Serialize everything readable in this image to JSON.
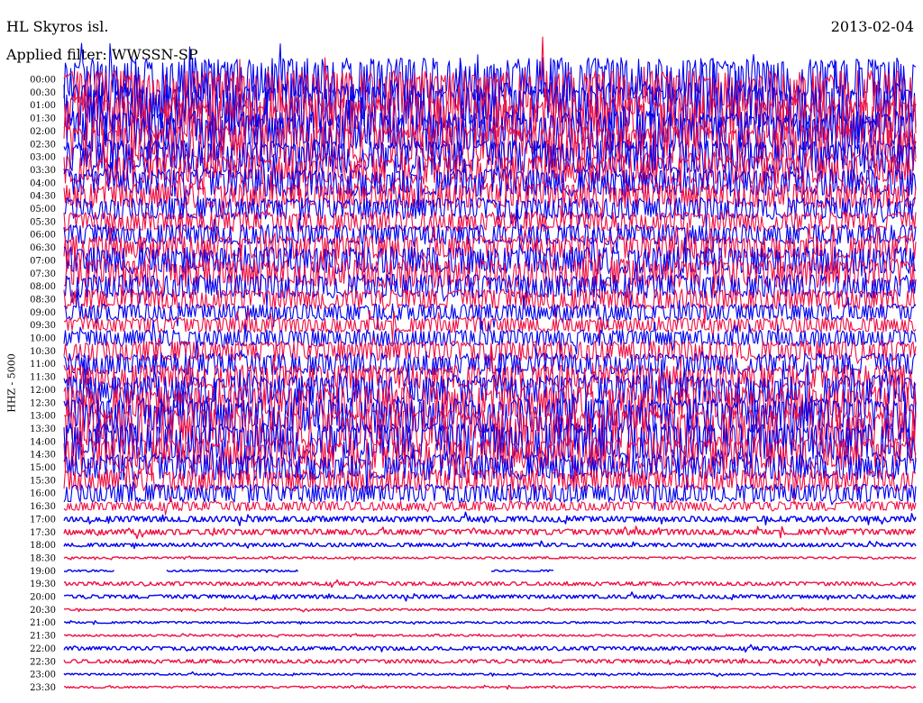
{
  "header": {
    "station": "HL Skyros isl.",
    "date": "2013-02-04",
    "filter": "Applied filter: WWSSN-SP"
  },
  "channel_label": "HHZ - 5000",
  "colors": {
    "blue": "#0000ee",
    "red": "#ee1144"
  },
  "chart_data": {
    "type": "line",
    "title": "HL Skyros isl.",
    "subtitle": "Applied filter: WWSSN-SP",
    "ylabel": "HHZ - 5000",
    "xlabel": "",
    "color_cycle": [
      "blue",
      "red"
    ],
    "series": [
      {
        "label": "00:00",
        "amplitude": 24
      },
      {
        "label": "00:30",
        "amplitude": 24
      },
      {
        "label": "01:00",
        "amplitude": 25
      },
      {
        "label": "01:30",
        "amplitude": 24
      },
      {
        "label": "02:00",
        "amplitude": 22
      },
      {
        "label": "02:30",
        "amplitude": 21
      },
      {
        "label": "03:00",
        "amplitude": 18
      },
      {
        "label": "03:30",
        "amplitude": 16
      },
      {
        "label": "04:00",
        "amplitude": 15
      },
      {
        "label": "04:30",
        "amplitude": 14
      },
      {
        "label": "05:00",
        "amplitude": 12
      },
      {
        "label": "05:30",
        "amplitude": 11
      },
      {
        "label": "06:00",
        "amplitude": 11
      },
      {
        "label": "06:30",
        "amplitude": 13
      },
      {
        "label": "07:00",
        "amplitude": 15
      },
      {
        "label": "07:30",
        "amplitude": 16
      },
      {
        "label": "08:00",
        "amplitude": 13
      },
      {
        "label": "08:30",
        "amplitude": 11
      },
      {
        "label": "09:00",
        "amplitude": 9
      },
      {
        "label": "09:30",
        "amplitude": 8
      },
      {
        "label": "10:00",
        "amplitude": 9
      },
      {
        "label": "10:30",
        "amplitude": 11
      },
      {
        "label": "11:00",
        "amplitude": 12
      },
      {
        "label": "11:30",
        "amplitude": 13
      },
      {
        "label": "12:00",
        "amplitude": 16
      },
      {
        "label": "12:30",
        "amplitude": 18
      },
      {
        "label": "13:00",
        "amplitude": 19
      },
      {
        "label": "13:30",
        "amplitude": 21
      },
      {
        "label": "14:00",
        "amplitude": 20
      },
      {
        "label": "14:30",
        "amplitude": 17
      },
      {
        "label": "15:00",
        "amplitude": 14
      },
      {
        "label": "15:30",
        "amplitude": 12
      },
      {
        "label": "16:00",
        "amplitude": 10
      },
      {
        "label": "16:30",
        "amplitude": 5
      },
      {
        "label": "17:00",
        "amplitude": 3
      },
      {
        "label": "17:30",
        "amplitude": 3
      },
      {
        "label": "18:00",
        "amplitude": 2
      },
      {
        "label": "18:30",
        "amplitude": 1
      },
      {
        "label": "19:00",
        "amplitude": 1,
        "gaps": [
          [
            0.06,
            0.12
          ],
          [
            0.275,
            0.5
          ],
          [
            0.575,
            1.0
          ]
        ]
      },
      {
        "label": "19:30",
        "amplitude": 2
      },
      {
        "label": "20:00",
        "amplitude": 2
      },
      {
        "label": "20:30",
        "amplitude": 1
      },
      {
        "label": "21:00",
        "amplitude": 1
      },
      {
        "label": "21:30",
        "amplitude": 1
      },
      {
        "label": "22:00",
        "amplitude": 2
      },
      {
        "label": "22:30",
        "amplitude": 2
      },
      {
        "label": "23:00",
        "amplitude": 1
      },
      {
        "label": "23:30",
        "amplitude": 1
      }
    ]
  }
}
